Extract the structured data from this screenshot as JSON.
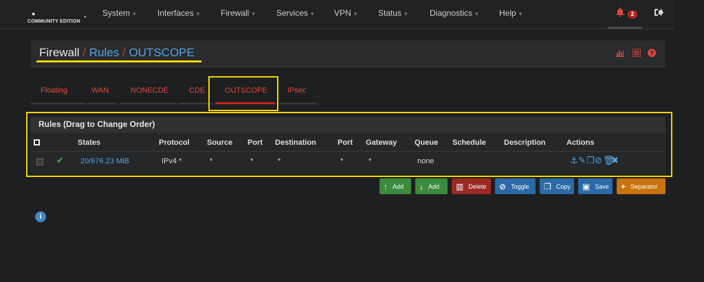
{
  "brand": {
    "edition": "COMMUNITY EDITION"
  },
  "nav": {
    "items": [
      {
        "label": "System"
      },
      {
        "label": "Interfaces"
      },
      {
        "label": "Firewall"
      },
      {
        "label": "Services"
      },
      {
        "label": "VPN"
      },
      {
        "label": "Status"
      },
      {
        "label": "Diagnostics"
      },
      {
        "label": "Help"
      }
    ],
    "notifications_count": "2"
  },
  "breadcrumb": {
    "part1": "Firewall",
    "sep": "/",
    "part2": "Rules",
    "part3": "OUTSCOPE"
  },
  "tabs": [
    {
      "label": "Floating"
    },
    {
      "label": "WAN"
    },
    {
      "label": "NONECDE"
    },
    {
      "label": "CDE"
    },
    {
      "label": "OUTSCOPE",
      "active": true
    },
    {
      "label": "IPsec"
    }
  ],
  "panel": {
    "title": "Rules (Drag to Change Order)"
  },
  "table": {
    "headers": [
      "States",
      "Protocol",
      "Source",
      "Port",
      "Destination",
      "Port",
      "Gateway",
      "Queue",
      "Schedule",
      "Description",
      "Actions"
    ],
    "row": {
      "states": "20/676.23 MiB",
      "protocol": "IPv4 *",
      "source": "*",
      "source_port": "*",
      "destination": "*",
      "dest_port": "*",
      "gateway": "*",
      "queue": "none",
      "schedule": "",
      "description": ""
    }
  },
  "buttons": {
    "add_top": "Add",
    "add_bottom": "Add",
    "delete": "Delete",
    "toggle": "Toggle",
    "copy": "Copy",
    "save": "Save",
    "separator": "Separator"
  },
  "colors": {
    "accent_red": "#e0493c",
    "link_blue": "#56a3e0",
    "highlight": "#f2d600"
  }
}
